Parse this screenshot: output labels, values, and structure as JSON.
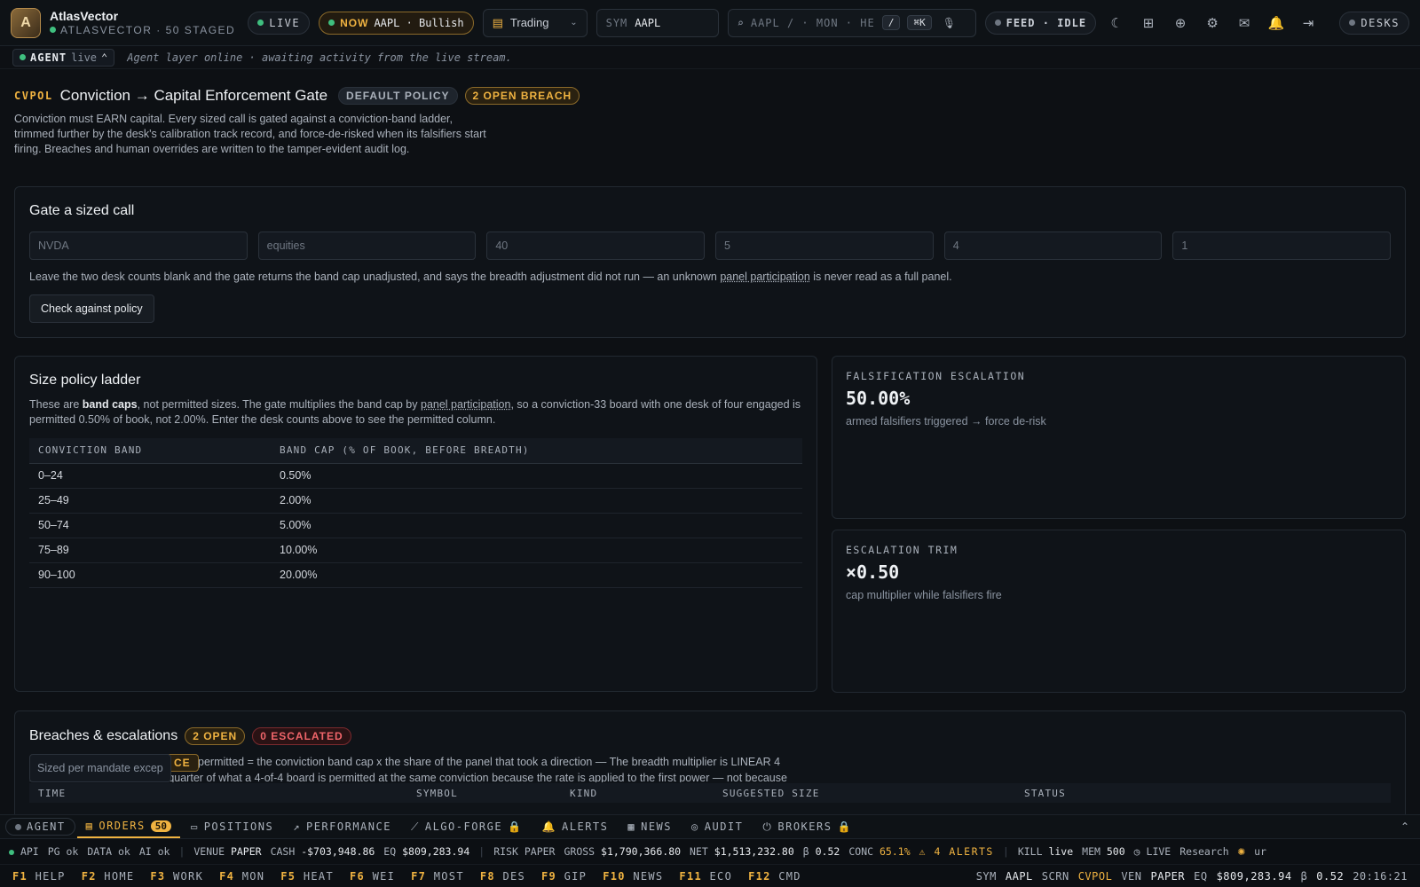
{
  "topbar": {
    "logo_letter": "A",
    "brand_name": "AtlasVector",
    "brand_sub": "ATLASVECTOR · 50 STAGED",
    "live_label": "LIVE",
    "now_label": "NOW",
    "now_value": "AAPL · Bullish",
    "workspace": "Trading",
    "sym_label": "SYM",
    "sym_value": "AAPL",
    "search_placeholder": "AAPL / · MON · HE",
    "search_kbd1": "/",
    "search_kbd2": "⌘K",
    "feed_label": "FEED · IDLE",
    "desks_label": "DESKS"
  },
  "agent_strip": {
    "label": "AGENT",
    "state": "live",
    "message": "Agent layer online · awaiting activity from the live stream."
  },
  "header": {
    "code": "CVPOL",
    "title": "Conviction → Capital Enforcement Gate",
    "badge_policy": "DEFAULT POLICY",
    "badge_breach": "2 OPEN BREACH",
    "description": "Conviction must EARN capital. Every sized call is gated against a conviction-band ladder, trimmed further by the desk's calibration track record, and force-de-risked when its falsifiers start firing. Breaches and human overrides are written to the tamper-evident audit log."
  },
  "gate": {
    "title": "Gate a sized call",
    "inputs": [
      "NVDA",
      "equities",
      "40",
      "5",
      "4",
      "1"
    ],
    "hint_pre": "Leave the two desk counts blank and the gate returns the band cap unadjusted, and says the breadth adjustment did not run — an unknown ",
    "hint_link": "panel participation",
    "hint_post": " is never read as a full panel.",
    "button": "Check against policy"
  },
  "ladder": {
    "title": "Size policy ladder",
    "desc_1": "These are ",
    "desc_bold": "band caps",
    "desc_2": ", not permitted sizes. The gate multiplies the band cap by ",
    "desc_link": "panel participation",
    "desc_3": ", so a conviction-33 board with one desk of four engaged is permitted 0.50% of book, not 2.00%. Enter the desk counts above to see the permitted column.",
    "col1": "CONVICTION BAND",
    "col2": "BAND CAP (% OF BOOK, BEFORE BREADTH)",
    "rows": [
      {
        "band": "0–24",
        "cap": "0.50%"
      },
      {
        "band": "25–49",
        "cap": "2.00%"
      },
      {
        "band": "50–74",
        "cap": "5.00%"
      },
      {
        "band": "75–89",
        "cap": "10.00%"
      },
      {
        "band": "90–100",
        "cap": "20.00%"
      }
    ]
  },
  "falsification": {
    "label": "FALSIFICATION ESCALATION",
    "value": "50.00%",
    "sub": "armed falsifiers triggered → force de-risk"
  },
  "trim": {
    "label": "ESCALATION TRIM",
    "value": "×0.50",
    "sub": "cap multiplier while falsifiers fire"
  },
  "breaches": {
    "title": "Breaches & escalations",
    "badge_open": "2 OPEN",
    "badge_escalated": "0 ESCALATED",
    "input_placeholder": "Sized per mandate excep",
    "badge_partial": "CE",
    "text": "permitted = the conviction band cap x the share of the panel that took a direction — The breadth multiplier is LINEAR 4 board is permitted exactly a quarter of what a 4-of-4 board is permitted at the same conviction because the rate is applied to the first power — not because anything measured that a quarter is right. A square, a square root or a step would all be defensible; calibrating between",
    "cols": [
      "TIME",
      "SYMBOL",
      "KIND",
      "SUGGESTED SIZE",
      "STATUS"
    ]
  },
  "tabs": [
    {
      "label": "AGENT"
    },
    {
      "label": "ORDERS",
      "count": "50"
    },
    {
      "label": "POSITIONS"
    },
    {
      "label": "PERFORMANCE"
    },
    {
      "label": "ALGO-FORGE"
    },
    {
      "label": "ALERTS"
    },
    {
      "label": "NEWS"
    },
    {
      "label": "AUDIT"
    },
    {
      "label": "BROKERS"
    }
  ],
  "status": {
    "api": "API",
    "pg": "PG ok",
    "data": "DATA ok",
    "ai": "AI ok",
    "venue_k": "VENUE",
    "venue_v": "PAPER",
    "cash_k": "CASH",
    "cash_v": "-$703,948.86",
    "eq_k": "EQ",
    "eq_v": "$809,283.94",
    "risk_k": "RISK",
    "risk_v": "PAPER",
    "gross_k": "GROSS",
    "gross_v": "$1,790,366.80",
    "net_k": "NET",
    "net_v": "$1,513,232.80",
    "beta_k": "β",
    "beta_v": "0.52",
    "conc_k": "CONC",
    "conc_v": "65.1%",
    "alerts": "⚠ 4 ALERTS",
    "kill_k": "KILL",
    "kill_v": "live",
    "mem_k": "MEM",
    "mem_v": "500",
    "live": "LIVE",
    "research": "Research",
    "ur": "ur"
  },
  "fkeys": [
    {
      "k": "F1",
      "l": "HELP"
    },
    {
      "k": "F2",
      "l": "HOME"
    },
    {
      "k": "F3",
      "l": "WORK"
    },
    {
      "k": "F4",
      "l": "MON"
    },
    {
      "k": "F5",
      "l": "HEAT"
    },
    {
      "k": "F6",
      "l": "WEI"
    },
    {
      "k": "F7",
      "l": "MOST"
    },
    {
      "k": "F8",
      "l": "DES"
    },
    {
      "k": "F9",
      "l": "GIP"
    },
    {
      "k": "F10",
      "l": "NEWS"
    },
    {
      "k": "F11",
      "l": "ECO"
    },
    {
      "k": "F12",
      "l": "CMD"
    }
  ],
  "fright": {
    "sym_k": "SYM",
    "sym_v": "AAPL",
    "scrn_k": "SCRN",
    "scrn_v": "CVPOL",
    "ven_k": "VEN",
    "ven_v": "PAPER",
    "eq_k": "EQ",
    "eq_v": "$809,283.94",
    "beta_k": "β",
    "beta_v": "0.52",
    "time": "20:16:21"
  }
}
